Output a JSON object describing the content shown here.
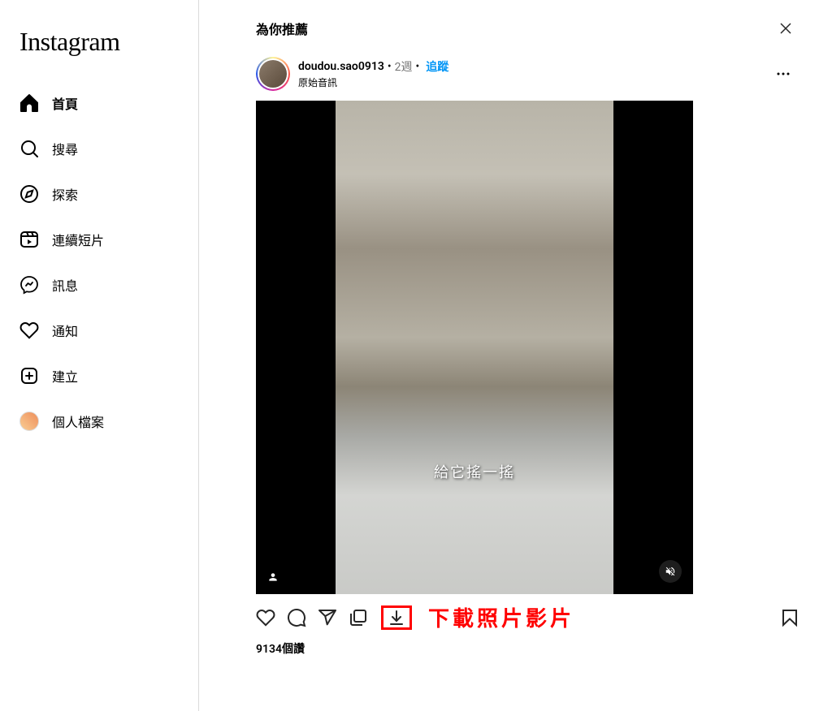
{
  "app_name": "Instagram",
  "sidebar": {
    "items": [
      {
        "label": "首頁",
        "icon": "home",
        "active": true
      },
      {
        "label": "搜尋",
        "icon": "search",
        "active": false
      },
      {
        "label": "探索",
        "icon": "compass",
        "active": false
      },
      {
        "label": "連續短片",
        "icon": "reels",
        "active": false
      },
      {
        "label": "訊息",
        "icon": "messenger",
        "active": false
      },
      {
        "label": "通知",
        "icon": "heart",
        "active": false
      },
      {
        "label": "建立",
        "icon": "plus-square",
        "active": false
      },
      {
        "label": "個人檔案",
        "icon": "avatar",
        "active": false
      }
    ]
  },
  "header": {
    "title": "為你推薦"
  },
  "post": {
    "username": "doudou.sao0913",
    "time_ago": "2週",
    "follow_label": "追蹤",
    "audio_label": "原始音訊",
    "video_caption": "給它搖一搖",
    "likes": "9134個讚"
  },
  "annotation": {
    "download_text": "下載照片影片"
  }
}
